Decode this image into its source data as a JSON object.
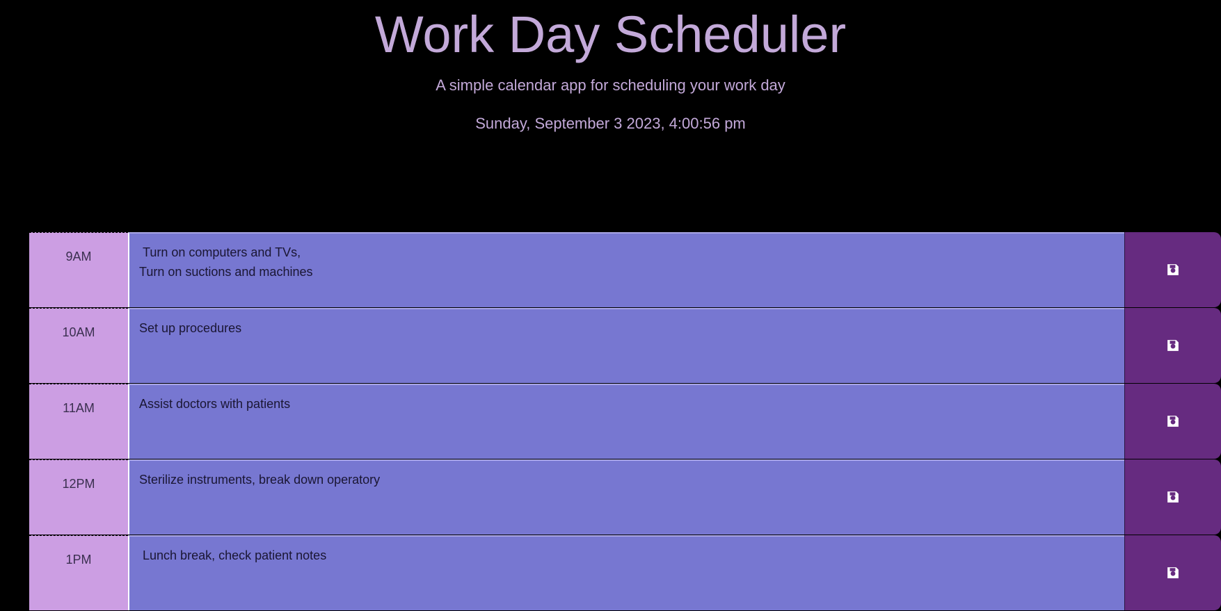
{
  "header": {
    "title": "Work Day Scheduler",
    "subtitle": "A simple calendar app for scheduling your work day",
    "current_datetime": "Sunday, September 3 2023, 4:00:56 pm"
  },
  "colors": {
    "background": "#000000",
    "header_text": "#c3a9d9",
    "hour_column": "#cc9ee3",
    "future_row": "#7777d1",
    "save_button": "#662b80"
  },
  "rows": [
    {
      "hour": "9AM",
      "text": " Turn on computers and TVs,\nTurn on suctions and machines",
      "save_icon": "floppy-disk-icon"
    },
    {
      "hour": "10AM",
      "text": "Set up procedures",
      "save_icon": "floppy-disk-icon"
    },
    {
      "hour": "11AM",
      "text": "Assist doctors with patients",
      "save_icon": "floppy-disk-icon"
    },
    {
      "hour": "12PM",
      "text": "Sterilize instruments, break down operatory",
      "save_icon": "floppy-disk-icon"
    },
    {
      "hour": "1PM",
      "text": " Lunch break, check patient notes",
      "save_icon": "floppy-disk-icon"
    }
  ]
}
